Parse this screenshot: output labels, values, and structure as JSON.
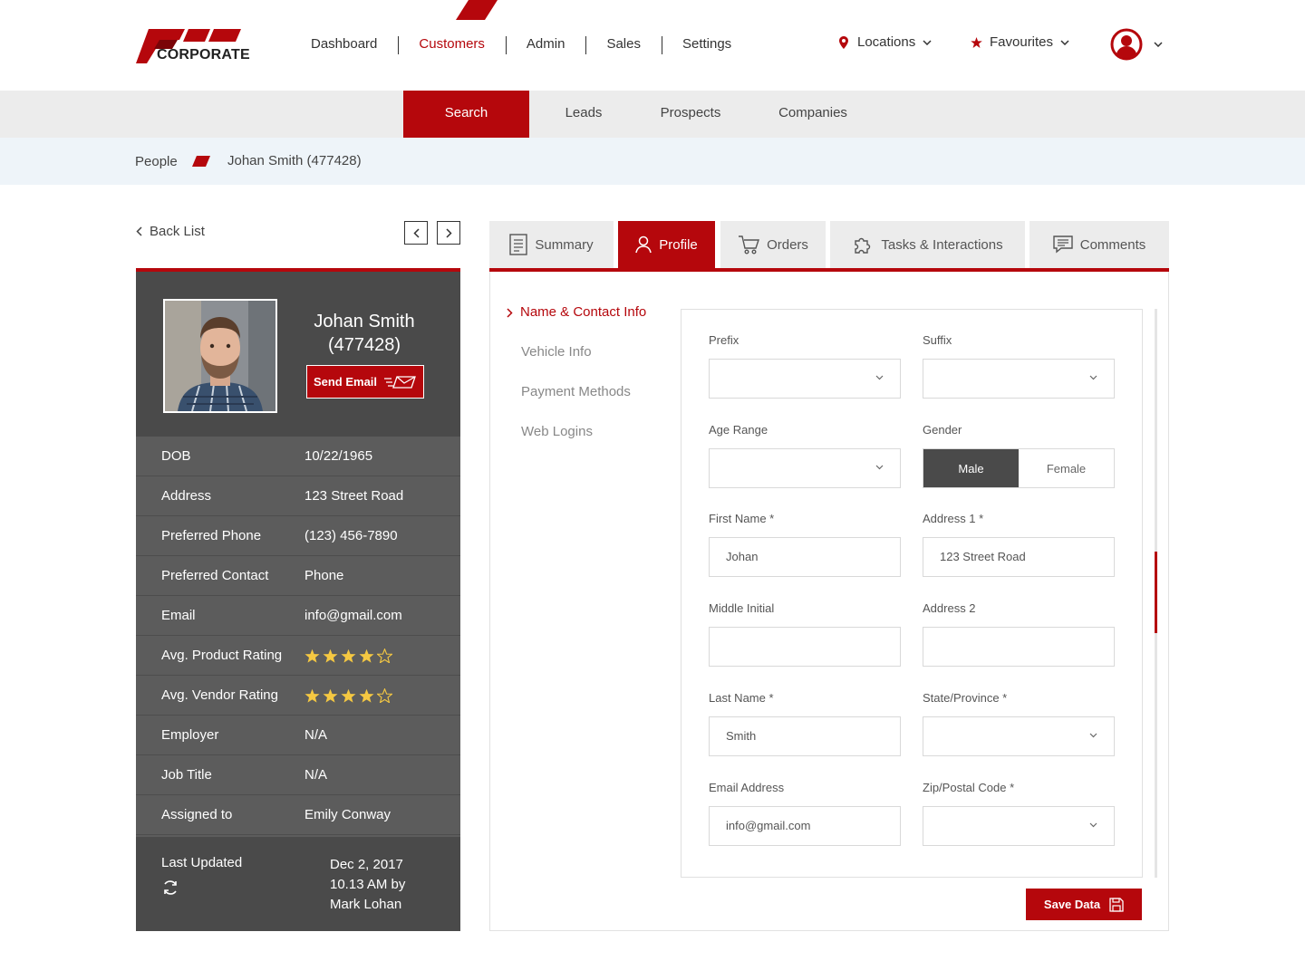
{
  "header": {
    "logo_text": "CORPORATE",
    "nav": [
      "Dashboard",
      "Customers",
      "Admin",
      "Sales",
      "Settings"
    ],
    "locations_label": "Locations",
    "favourites_label": "Favourites"
  },
  "subnav": [
    "Search",
    "Leads",
    "Prospects",
    "Companies"
  ],
  "breadcrumb": {
    "parent": "People",
    "current": "Johan Smith (477428)"
  },
  "left": {
    "back_label": "Back List",
    "name_line1": "Johan Smith",
    "name_line2": "(477428)",
    "send_email": "Send Email",
    "rows": [
      {
        "k": "DOB",
        "v": "10/22/1965"
      },
      {
        "k": "Address",
        "v": "123 Street Road"
      },
      {
        "k": "Preferred Phone",
        "v": "(123) 456-7890"
      },
      {
        "k": "Preferred Contact",
        "v": "Phone"
      },
      {
        "k": "Email",
        "v": "info@gmail.com"
      },
      {
        "k": "Avg. Product Rating",
        "v": "",
        "rating": 4
      },
      {
        "k": "Avg. Vendor Rating",
        "v": "",
        "rating": 4
      },
      {
        "k": "Employer",
        "v": "N/A"
      },
      {
        "k": "Job Title",
        "v": "N/A"
      },
      {
        "k": "Assigned to",
        "v": "Emily Conway"
      }
    ],
    "last_updated_label": "Last Updated",
    "last_updated_lines": [
      "Dec 2, 2017",
      "10.13 AM by",
      "Mark Lohan"
    ]
  },
  "tabs": [
    "Summary",
    "Profile",
    "Orders",
    "Tasks & Interactions",
    "Comments"
  ],
  "side_menu": [
    "Name & Contact Info",
    "Vehicle Info",
    "Payment Methods",
    "Web Logins"
  ],
  "form": {
    "prefix_label": "Prefix",
    "suffix_label": "Suffix",
    "age_label": "Age Range",
    "gender_label": "Gender",
    "gender_options": [
      "Male",
      "Female"
    ],
    "first_name_label": "First Name *",
    "first_name_value": "Johan",
    "address1_label": "Address 1 *",
    "address1_value": "123 Street Road",
    "middle_label": "Middle Initial",
    "address2_label": "Address 2",
    "last_name_label": "Last Name *",
    "last_name_value": "Smith",
    "state_label": "State/Province *",
    "email_label": "Email Address",
    "email_value": "info@gmail.com",
    "zip_label": "Zip/Postal Code *"
  },
  "save_label": "Save Data",
  "colors": {
    "accent": "#b5070c",
    "panel": "#5c5c5c",
    "panel_dark": "#4a4a4a",
    "star": "#f5c842"
  }
}
